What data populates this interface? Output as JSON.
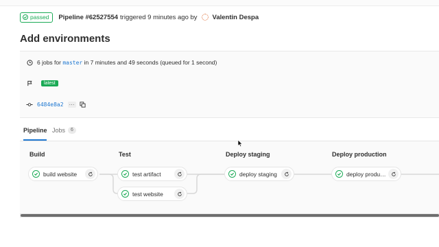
{
  "header": {
    "status": "passed",
    "pipeline_id": "Pipeline #62527554",
    "triggered_text": "triggered 9 minutes ago by",
    "user_name": "Valentin Despa"
  },
  "page_title": "Add environments",
  "info": {
    "jobs_prefix": "6 jobs for",
    "branch": "master",
    "jobs_suffix": "in 7 minutes and 49 seconds (queued for 1 second)",
    "badge": "latest",
    "commit_sha": "6484e8a2",
    "ellipsis": "···"
  },
  "tabs": {
    "pipeline": "Pipeline",
    "jobs": "Jobs",
    "jobs_count": "6"
  },
  "stages": [
    {
      "title": "Build",
      "jobs": [
        "build website"
      ]
    },
    {
      "title": "Test",
      "jobs": [
        "test artifact",
        "test website"
      ]
    },
    {
      "title": "Deploy staging",
      "jobs": [
        "deploy staging"
      ]
    },
    {
      "title": "Deploy production",
      "jobs": [
        "deploy production"
      ]
    }
  ],
  "colors": {
    "success": "#1aaa55",
    "link": "#1f78d1"
  },
  "icons": {
    "status": "check-circle-icon",
    "clock": "clock-icon",
    "flag": "flag-icon",
    "commit": "commit-icon",
    "copy": "copy-icon",
    "retry": "retry-icon"
  }
}
